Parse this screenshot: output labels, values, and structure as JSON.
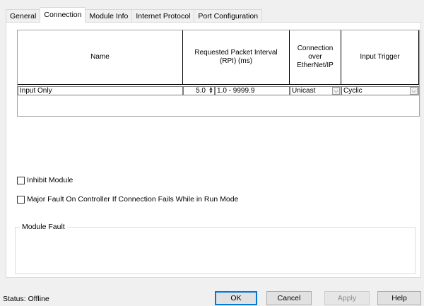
{
  "tabs": [
    "General",
    "Connection",
    "Module Info",
    "Internet Protocol",
    "Port Configuration"
  ],
  "table": {
    "headers": {
      "name": "Name",
      "rpi": "Requested Packet Interval (RPI) (ms)",
      "connection": "Connection over EtherNet/IP",
      "trigger": "Input Trigger"
    },
    "row": {
      "name": "Input Only",
      "rpi_value": "5.0",
      "rpi_range": "1.0 - 9999.9",
      "connection": "Unicast",
      "trigger": "Cyclic"
    }
  },
  "options": {
    "inhibit_label": "Inhibit Module",
    "major_fault_label": "Major Fault On Controller If Connection Fails While in Run Mode"
  },
  "module_fault": {
    "label": "Module Fault"
  },
  "status": "Status:  Offline",
  "buttons": {
    "ok": "OK",
    "cancel": "Cancel",
    "apply": "Apply",
    "help": "Help"
  }
}
